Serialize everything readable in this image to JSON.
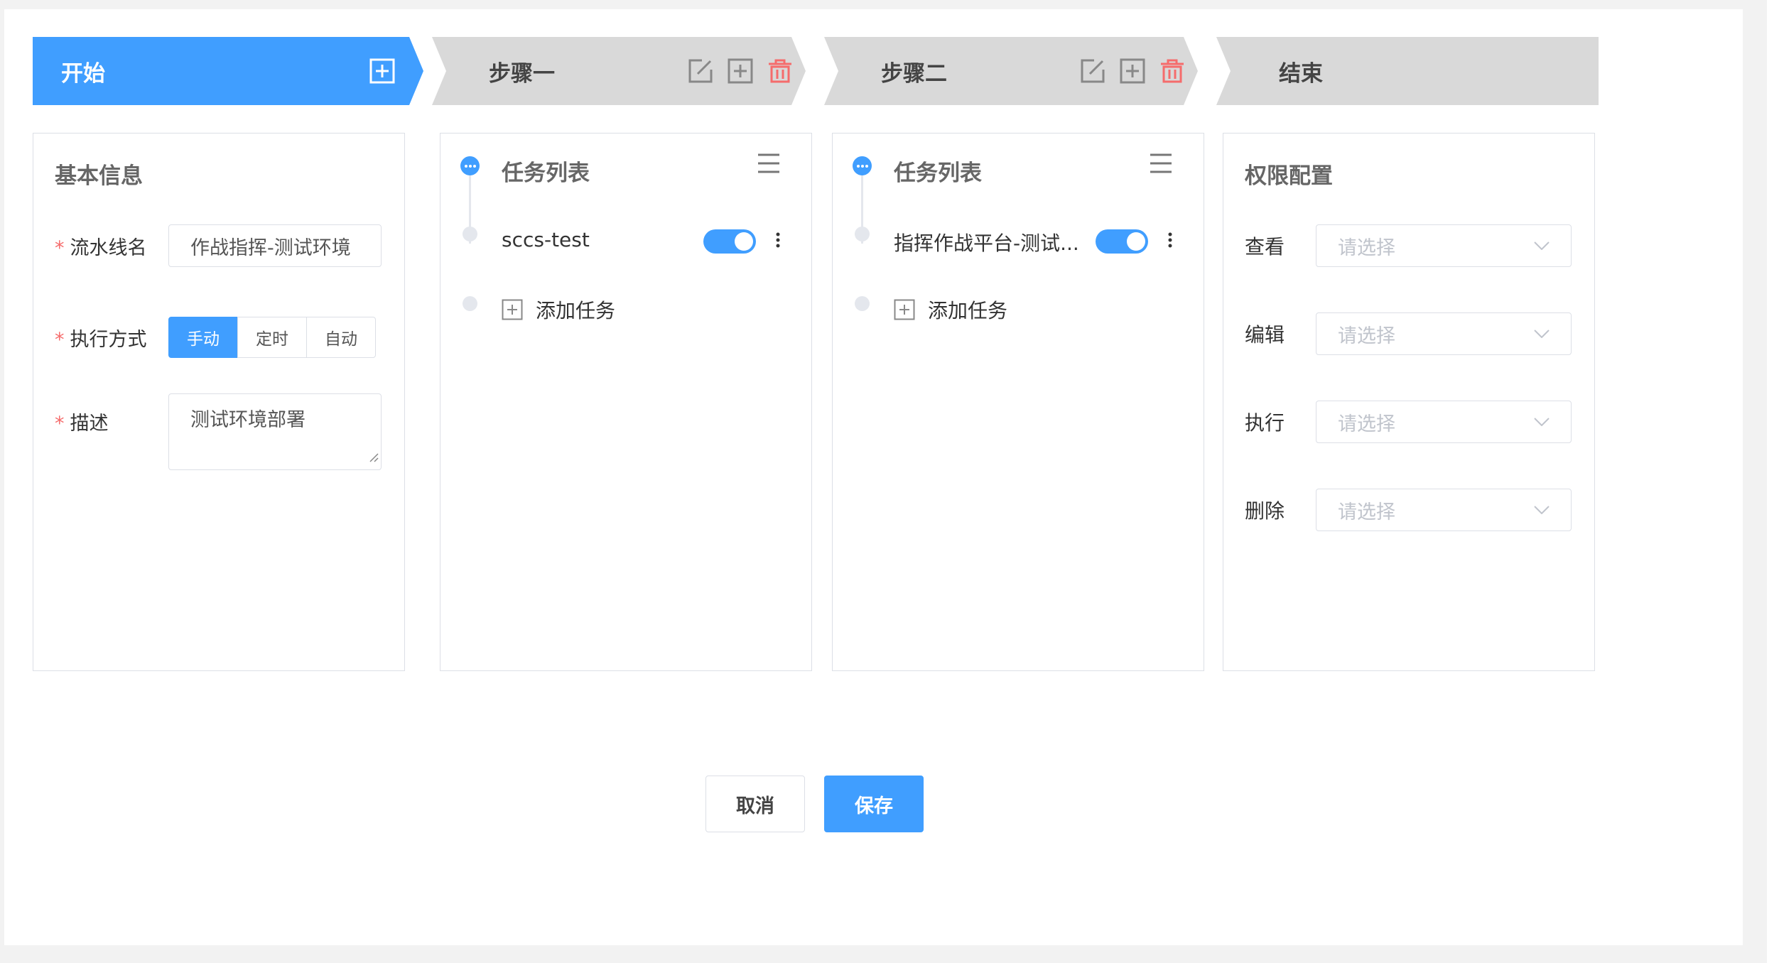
{
  "colors": {
    "primary": "#409eff",
    "danger": "#f56c6c",
    "step_inactive": "#d9d9d9"
  },
  "steps": [
    {
      "label": "开始",
      "icons": [
        "add-box-icon"
      ]
    },
    {
      "label": "步骤一",
      "icons": [
        "edit-icon",
        "add-box-icon",
        "delete-icon"
      ]
    },
    {
      "label": "步骤二",
      "icons": [
        "edit-icon",
        "add-box-icon",
        "delete-icon"
      ]
    },
    {
      "label": "结束",
      "icons": []
    }
  ],
  "basic": {
    "title": "基本信息",
    "pipeline_name_label": "流水线名",
    "pipeline_name_value": "作战指挥-测试环境",
    "exec_mode_label": "执行方式",
    "exec_modes": [
      "手动",
      "定时",
      "自动"
    ],
    "exec_mode_selected": "手动",
    "desc_label": "描述",
    "desc_value": "测试环境部署"
  },
  "stage1": {
    "title": "任务列表",
    "task_name": "sccs-test",
    "task_enabled": true,
    "add_task_label": "添加任务"
  },
  "stage2": {
    "title": "任务列表",
    "task_name": "指挥作战平台-测试...",
    "task_enabled": true,
    "add_task_label": "添加任务"
  },
  "perm": {
    "title": "权限配置",
    "rows": [
      {
        "label": "查看",
        "placeholder": "请选择"
      },
      {
        "label": "编辑",
        "placeholder": "请选择"
      },
      {
        "label": "执行",
        "placeholder": "请选择"
      },
      {
        "label": "删除",
        "placeholder": "请选择"
      }
    ]
  },
  "footer": {
    "cancel_label": "取消",
    "save_label": "保存"
  }
}
